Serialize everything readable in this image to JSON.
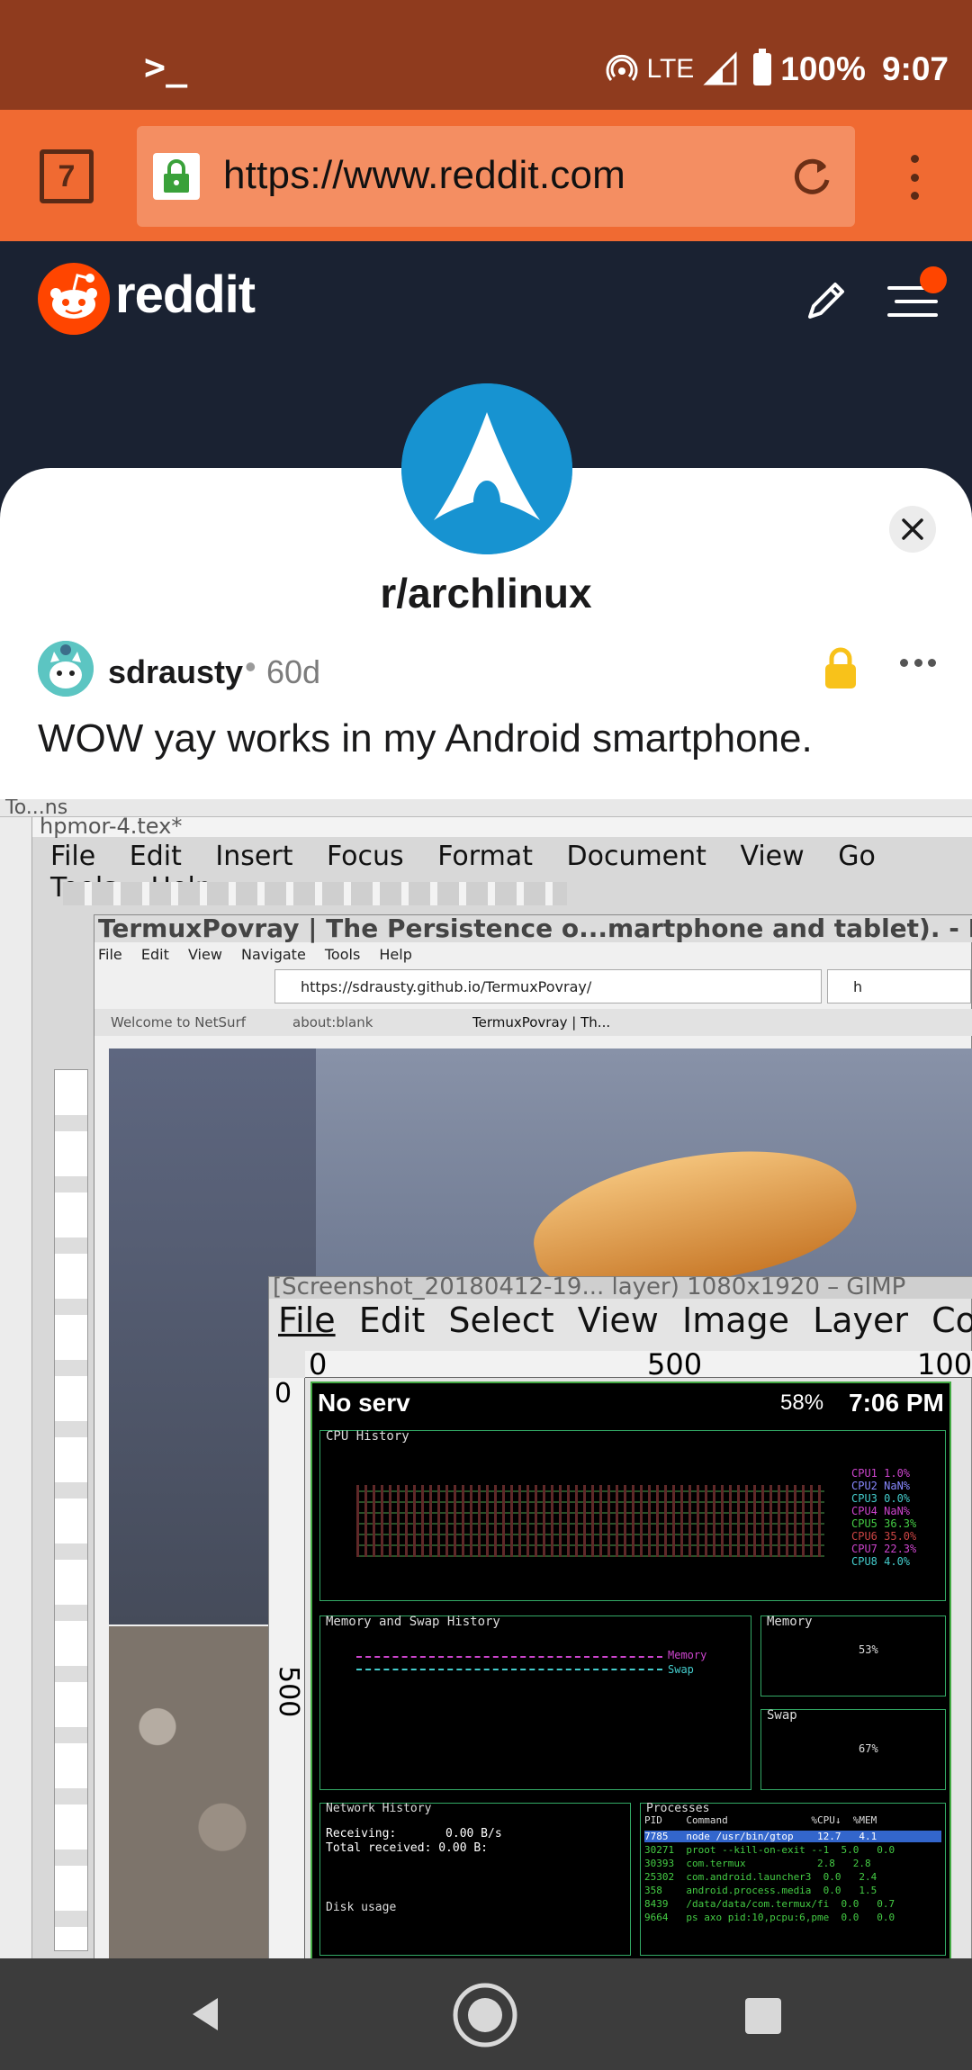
{
  "status_bar": {
    "terminal_glyph": ">_",
    "network": "LTE",
    "battery": "100%",
    "time": "9:07"
  },
  "browser": {
    "tab_count": "7",
    "url": "https://www.reddit.com"
  },
  "reddit": {
    "brand": "reddit"
  },
  "post": {
    "subreddit": "r/archlinux",
    "author": "sdrausty",
    "separator": "•",
    "age": "60d",
    "title": "WOW yay works in my Android smartphone."
  },
  "embedded": {
    "kile_title": "To...ns",
    "doc_tab": "hpmor-4.tex*",
    "kile_menu": [
      "File",
      "Edit",
      "Insert",
      "Focus",
      "Format",
      "Document",
      "View",
      "Go",
      "Tools",
      "Help"
    ],
    "netsurf_title": "TermuxPovray | The Persistence o...martphone and tablet). - NetSurf",
    "netsurf_menu": [
      "File",
      "Edit",
      "View",
      "Navigate",
      "Tools",
      "Help"
    ],
    "netsurf_url": "https://sdrausty.github.io/TermuxPovray/",
    "netsurf_search": "h",
    "netsurf_tabs": [
      "Welcome to NetSurf",
      "about:blank",
      "TermuxPovray | Th..."
    ],
    "gimp_title": "[Screenshot_20180412-19... layer) 1080x1920 – GIMP",
    "gimp_menu": [
      "File",
      "Edit",
      "Select",
      "View",
      "Image",
      "Layer",
      "Colors"
    ],
    "ruler_labels": [
      "0",
      "500",
      "100"
    ],
    "vruler_labels": [
      "0",
      "500"
    ],
    "phone_status_left": "No serv",
    "phone_battery": "58%",
    "phone_time": "7:06 PM",
    "cpu_history_label": "CPU History",
    "cpu_rows": [
      "CPU1  1.0%",
      "CPU2  NaN%",
      "CPU3  0.0%",
      "CPU4  NaN%",
      "CPU5 36.3%",
      "CPU6 35.0%",
      "CPU7 22.3%",
      "CPU8  4.0%"
    ],
    "mem_history_label": "Memory and Swap History",
    "memory_label": "Memory",
    "memory_legend": "Memory",
    "swap_legend": "Swap",
    "memory_pct": "53%",
    "swap_label": "Swap",
    "swap_pct": "67%",
    "net_label": "Network History",
    "receiving": "Receiving:       0.00 B/s",
    "total_received": "Total received: 0.00 B:",
    "disk_label": "Disk usage",
    "processes_label": "Processes",
    "proc_header": "PID    Command              %CPU↓  %MEM",
    "proc_rows": [
      "7785   node /usr/bin/gtop    12.7   4.1",
      "30271  proot --kill-on-exit --1  5.0   0.0",
      "30393  com.termux            2.8   2.8",
      "25302  com.android.launcher3  0.0   2.4",
      "358    android.process.media  0.0   1.5",
      "8439   /data/data/com.termux/fi  0.0   0.7",
      "9664   ps axo pid:10,pcpu:6,pme  0.0   0.0"
    ]
  }
}
